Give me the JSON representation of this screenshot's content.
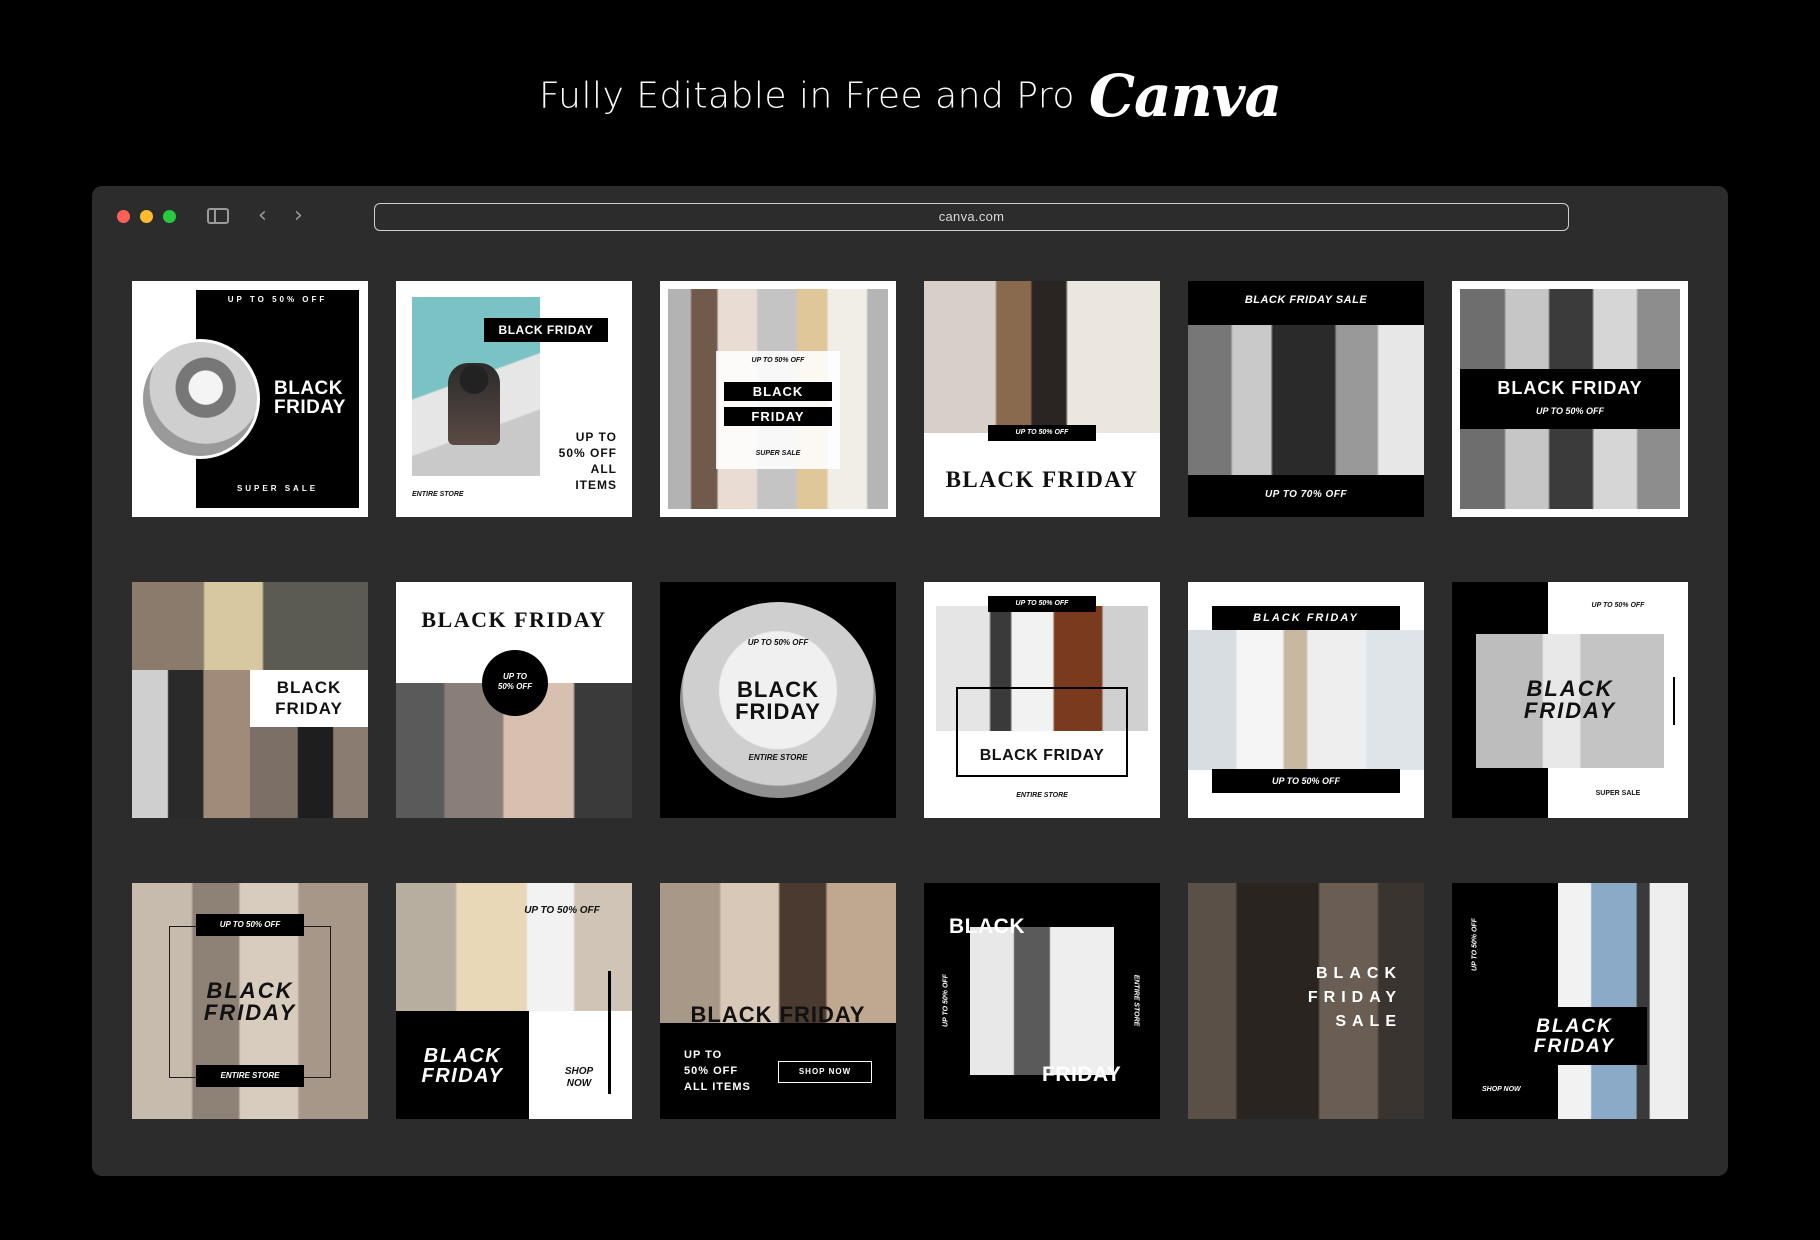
{
  "header": {
    "text": "Fully Editable in Free and Pro",
    "brand": "Canva"
  },
  "browser": {
    "url": "canva.com"
  },
  "icons": {
    "sidebar": "sidebar-toggle-icon",
    "back": "chevron-left-icon",
    "forward": "chevron-right-icon"
  },
  "tiles": {
    "t1": {
      "top": "UP TO 50% OFF",
      "l1": "BLACK",
      "l2": "FRIDAY",
      "bottom": "SUPER SALE"
    },
    "t2": {
      "badge": "BLACK FRIDAY",
      "l1": "UP TO",
      "l2": "50% OFF",
      "l3": "ALL",
      "l4": "ITEMS",
      "foot": "ENTIRE STORE"
    },
    "t3": {
      "top": "UP TO 50% OFF",
      "l1": "BLACK",
      "l2": "FRIDAY",
      "foot": "SUPER SALE"
    },
    "t4": {
      "badge": "UP TO 50% OFF",
      "title": "BLACK FRIDAY"
    },
    "t5": {
      "top": "BLACK FRIDAY SALE",
      "bottom": "UP TO 70% OFF"
    },
    "t6": {
      "title": "BLACK FRIDAY",
      "sub": "UP TO 50% OFF"
    },
    "t7": {
      "l1": "BLACK",
      "l2": "FRIDAY"
    },
    "t8": {
      "title": "BLACK FRIDAY",
      "c1": "UP TO",
      "c2": "50% OFF"
    },
    "t9": {
      "top": "UP TO 50% OFF",
      "l1": "BLACK",
      "l2": "FRIDAY",
      "foot": "ENTIRE STORE"
    },
    "t10": {
      "badge": "UP TO 50% OFF",
      "title": "BLACK FRIDAY",
      "foot": "ENTIRE STORE"
    },
    "t11": {
      "title": "BLACK FRIDAY",
      "bottom": "UP TO 50% OFF"
    },
    "t12": {
      "top": "UP TO 50% OFF",
      "l1": "BLACK",
      "l2": "FRIDAY",
      "foot": "SUPER SALE"
    },
    "t13": {
      "badge": "UP TO 50% OFF",
      "l1": "BLACK",
      "l2": "FRIDAY",
      "foot": "ENTIRE STORE"
    },
    "t14": {
      "top": "UP TO 50% OFF",
      "l1": "BLACK",
      "l2": "FRIDAY",
      "s1": "SHOP",
      "s2": "NOW"
    },
    "t15": {
      "title": "BLACK FRIDAY",
      "l1": "UP TO",
      "l2": "50% OFF",
      "l3": "ALL ITEMS",
      "btn": "SHOP NOW"
    },
    "t16": {
      "l1": "BLACK",
      "l2": "FRIDAY",
      "side_l": "UP TO 50% OFF",
      "side_r": "ENTIRE STORE"
    },
    "t17": {
      "l1": "BLACK",
      "l2": "FRIDAY",
      "l3": "SALE"
    },
    "t18": {
      "side": "UP TO 50% OFF",
      "l1": "BLACK",
      "l2": "FRIDAY",
      "foot": "SHOP NOW"
    }
  }
}
